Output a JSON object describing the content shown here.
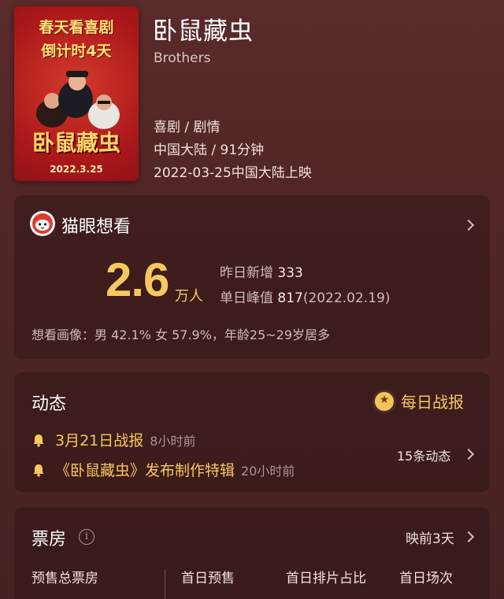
{
  "movie": {
    "title": "卧鼠藏虫",
    "english_title": "Brothers",
    "genre": "喜剧 / 剧情",
    "region_duration": "中国大陆 / 91分钟",
    "release": "2022-03-25中国大陆上映",
    "poster": {
      "line1": "春天看喜剧",
      "line2": "倒计时4天",
      "title_art": "卧鼠藏虫",
      "date": "2022.3.25"
    }
  },
  "want_to_see": {
    "title": "猫眼想看",
    "count": "2.6",
    "unit": "万人",
    "yesterday_label": "昨日新增",
    "yesterday_value": "333",
    "peak_label": "单日峰值",
    "peak_value": "817",
    "peak_date": "(2022.02.19)",
    "portrait": "想看画像：男 42.1%  女 57.9%，年龄25~29岁居多"
  },
  "news": {
    "title": "动态",
    "daily_report": "每日战报",
    "items": [
      {
        "text": "3月21日战报",
        "ago": "8小时前"
      },
      {
        "text": "《卧鼠藏虫》发布制作特辑",
        "ago": "20小时前"
      }
    ],
    "count_link": "15条动态"
  },
  "box_office": {
    "title": "票房",
    "info_glyph": "i",
    "countdown": "映前3天",
    "columns": [
      "预售总票房",
      "首日预售",
      "首日排片占比",
      "首日场次"
    ]
  },
  "colors": {
    "accent_gold": "#f6c85f",
    "background": "#4e2424",
    "card": "#2a1212"
  }
}
